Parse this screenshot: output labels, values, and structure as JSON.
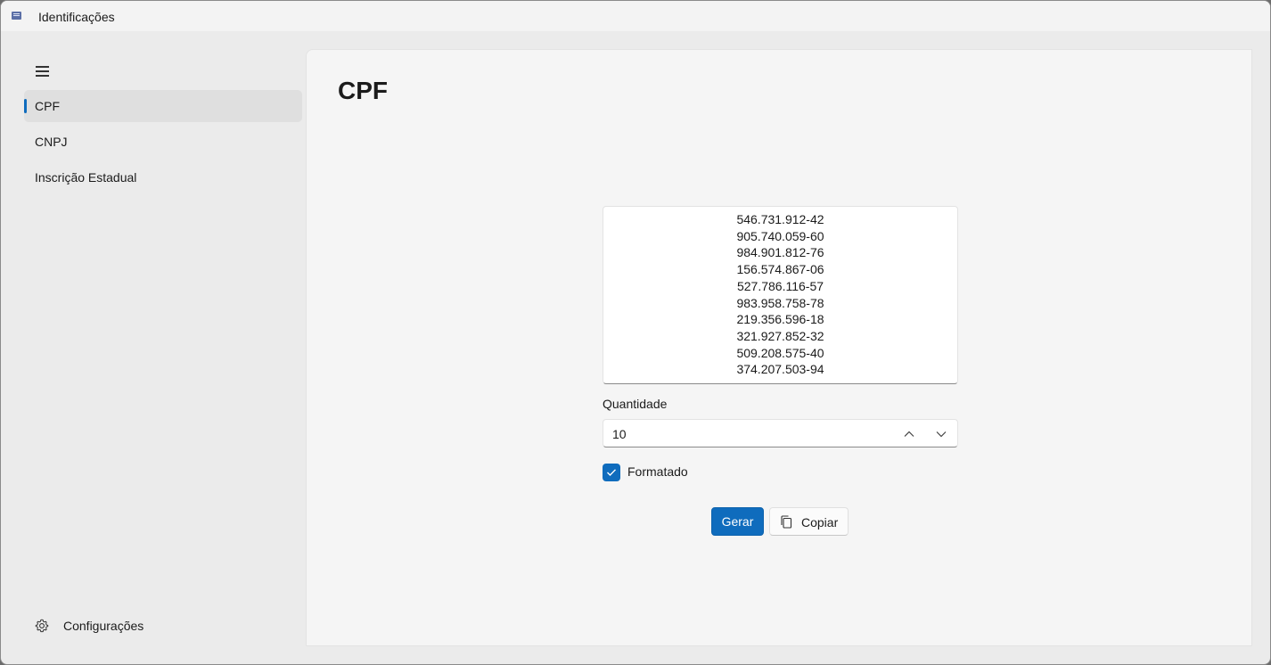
{
  "window": {
    "title": "Identificações"
  },
  "nav": {
    "items": [
      {
        "label": "CPF",
        "selected": true
      },
      {
        "label": "CNPJ",
        "selected": false
      },
      {
        "label": "Inscrição Estadual",
        "selected": false
      }
    ],
    "settings_label": "Configurações"
  },
  "page": {
    "title": "CPF",
    "output_lines": [
      "546.731.912-42",
      "905.740.059-60",
      "984.901.812-76",
      "156.574.867-06",
      "527.786.116-57",
      "983.958.758-78",
      "219.356.596-18",
      "321.927.852-32",
      "509.208.575-40",
      "374.207.503-94"
    ],
    "quantity_label": "Quantidade",
    "quantity_value": "10",
    "formatted_label": "Formatado",
    "formatted_checked": true,
    "generate_label": "Gerar",
    "copy_label": "Copiar"
  },
  "colors": {
    "accent": "#0f6cbd"
  }
}
